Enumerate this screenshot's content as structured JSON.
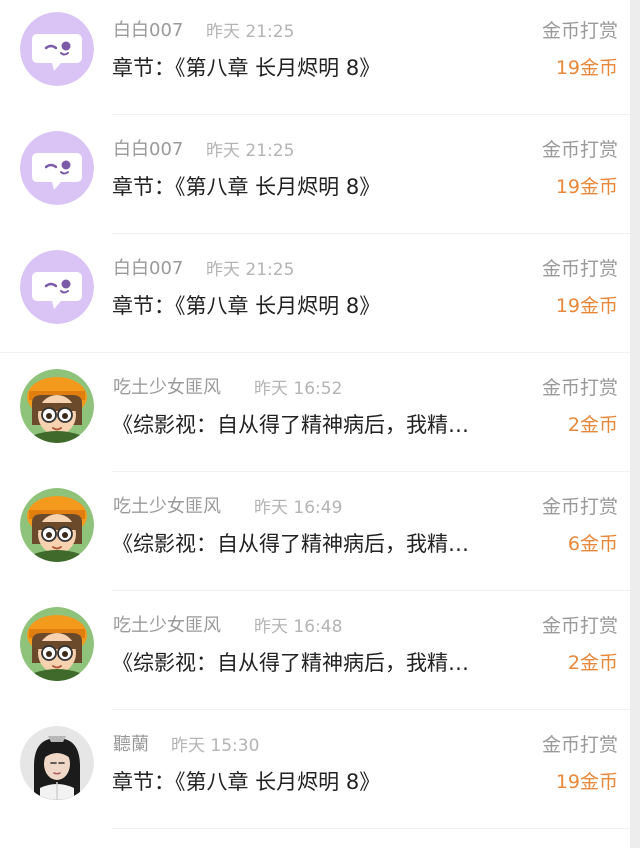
{
  "items": [
    {
      "name": "白白007",
      "time": "昨天 21:25",
      "content": "章节：《第八章 长月烬明 8》",
      "kind": "金币打赏",
      "coins": "19金币",
      "avatar": "chat-bubble"
    },
    {
      "name": "白白007",
      "time": "昨天 21:25",
      "content": "章节：《第八章 长月烬明 8》",
      "kind": "金币打赏",
      "coins": "19金币",
      "avatar": "chat-bubble"
    },
    {
      "name": "白白007",
      "time": "昨天 21:25",
      "content": "章节：《第八章 长月烬明 8》",
      "kind": "金币打赏",
      "coins": "19金币",
      "avatar": "chat-bubble"
    },
    {
      "name": "吃土少女匪风",
      "time": "昨天 16:52",
      "content": "《综影视：自从得了精神病后，我精…",
      "kind": "金币打赏",
      "coins": "2金币",
      "avatar": "cartoon-girl"
    },
    {
      "name": "吃土少女匪风",
      "time": "昨天 16:49",
      "content": "《综影视：自从得了精神病后，我精…",
      "kind": "金币打赏",
      "coins": "6金币",
      "avatar": "cartoon-girl"
    },
    {
      "name": "吃土少女匪风",
      "time": "昨天 16:48",
      "content": "《综影视：自从得了精神病后，我精…",
      "kind": "金币打赏",
      "coins": "2金币",
      "avatar": "cartoon-girl"
    },
    {
      "name": "聽蘭",
      "time": "昨天 15:30",
      "content": "章节：《第八章 长月烬明 8》",
      "kind": "金币打赏",
      "coins": "19金币",
      "avatar": "costume-portrait"
    }
  ],
  "colors": {
    "coins": "#e8883a",
    "muted": "#9a9a9a",
    "bubble": "#d9c4f5"
  }
}
